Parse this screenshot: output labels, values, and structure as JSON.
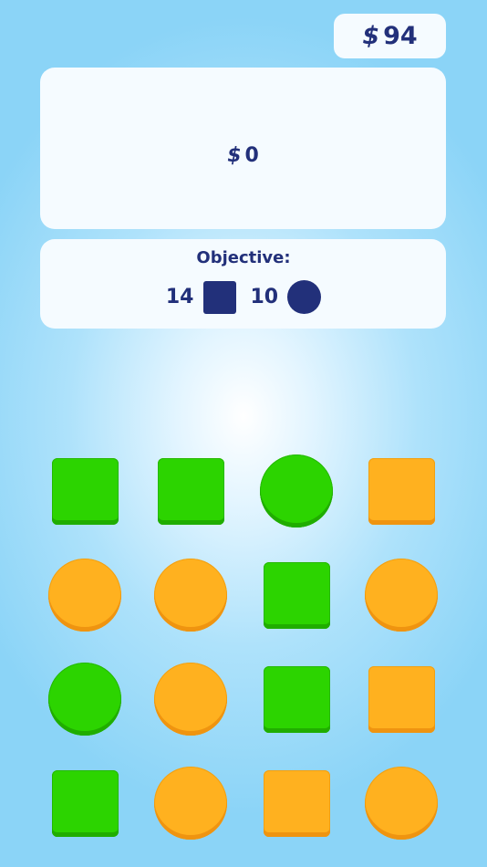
{
  "wallet": {
    "currency": "$",
    "amount": "94"
  },
  "score": {
    "currency": "$",
    "amount": "0"
  },
  "objective": {
    "title": "Objective:",
    "square_count": "14",
    "circle_count": "10"
  },
  "colors": {
    "navy": "#22307a",
    "green": "#2cd400",
    "orange": "#ffb11f",
    "panel": "#f5fbff"
  },
  "board": {
    "columns": 4,
    "rows": 4,
    "tiles": [
      {
        "shape": "square",
        "color": "green"
      },
      {
        "shape": "square",
        "color": "green"
      },
      {
        "shape": "circle",
        "color": "green"
      },
      {
        "shape": "square",
        "color": "orange"
      },
      {
        "shape": "circle",
        "color": "orange"
      },
      {
        "shape": "circle",
        "color": "orange"
      },
      {
        "shape": "square",
        "color": "green"
      },
      {
        "shape": "circle",
        "color": "orange"
      },
      {
        "shape": "circle",
        "color": "green"
      },
      {
        "shape": "circle",
        "color": "orange"
      },
      {
        "shape": "square",
        "color": "green"
      },
      {
        "shape": "square",
        "color": "orange"
      },
      {
        "shape": "square",
        "color": "green"
      },
      {
        "shape": "circle",
        "color": "orange"
      },
      {
        "shape": "square",
        "color": "orange"
      },
      {
        "shape": "circle",
        "color": "orange"
      }
    ]
  }
}
